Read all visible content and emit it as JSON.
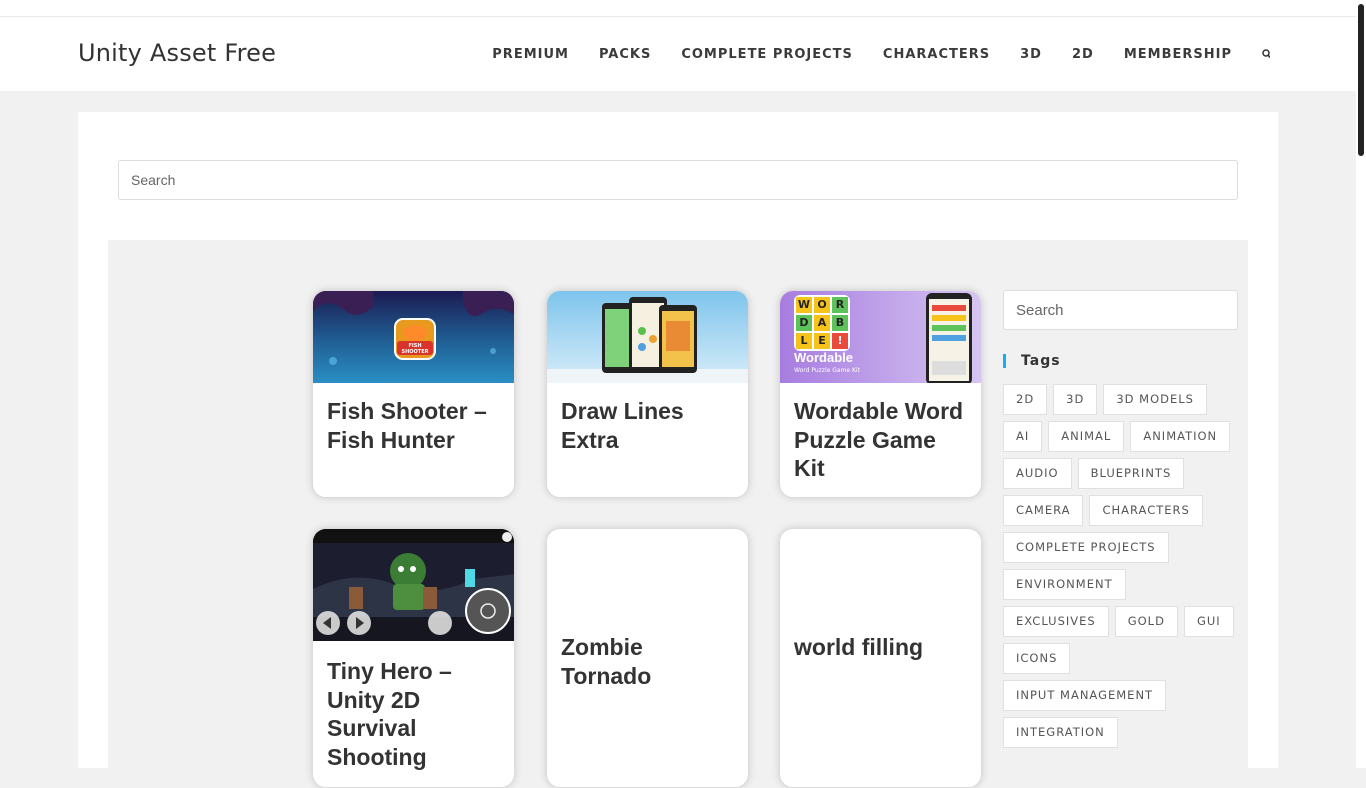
{
  "site": {
    "title": "Unity Asset Free"
  },
  "nav": {
    "items": [
      "PREMIUM",
      "PACKS",
      "COMPLETE PROJECTS",
      "CHARACTERS",
      "3D",
      "2D",
      "MEMBERSHIP"
    ],
    "search_icon": "search-icon"
  },
  "search": {
    "placeholder": "Search"
  },
  "cards": [
    {
      "title": "Fish Shooter – Fish Hunter",
      "thumb_text": "FISH SHOOTER"
    },
    {
      "title": "Draw Lines Extra"
    },
    {
      "title": "Wordable Word Puzzle Game Kit",
      "thumb_text": "Wordable",
      "thumb_subtext": "Word Puzzle Game Kit",
      "letters": [
        "W",
        "O",
        "R",
        "D",
        "A",
        "B",
        "L",
        "E",
        "!"
      ]
    },
    {
      "title": "Tiny Hero – Unity 2D Survival Shooting"
    },
    {
      "title": "Zombie Tornado"
    },
    {
      "title": "world filling"
    }
  ],
  "sidebar": {
    "search_placeholder": "Search",
    "tags_title": "Tags",
    "tags": [
      "2D",
      "3D",
      "3D MODELS",
      "AI",
      "ANIMAL",
      "ANIMATION",
      "AUDIO",
      "BLUEPRINTS",
      "CAMERA",
      "CHARACTERS",
      "COMPLETE PROJECTS",
      "ENVIRONMENT",
      "EXCLUSIVES",
      "GOLD",
      "GUI",
      "ICONS",
      "INPUT MANAGEMENT",
      "INTEGRATION"
    ]
  },
  "colors": {
    "accent": "#13aff0",
    "page_bg": "#f1f1f1",
    "card_bg": "#ffffff",
    "text": "#333333"
  }
}
